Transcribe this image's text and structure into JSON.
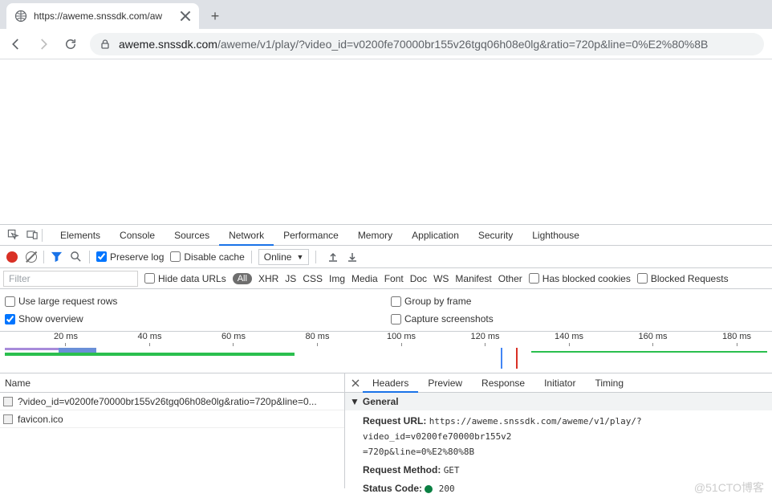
{
  "browser": {
    "tab_title": "https://aweme.snssdk.com/aw",
    "url_host": "aweme.snssdk.com",
    "url_path": "/aweme/v1/play/?video_id=v0200fe70000br155v26tgq06h08e0lg&ratio=720p&line=0%E2%80%8B"
  },
  "devtools": {
    "tabs": [
      "Elements",
      "Console",
      "Sources",
      "Network",
      "Performance",
      "Memory",
      "Application",
      "Security",
      "Lighthouse"
    ],
    "active_tab": "Network"
  },
  "network": {
    "preserve_log_label": "Preserve log",
    "disable_cache_label": "Disable cache",
    "online_label": "Online",
    "filter_placeholder": "Filter",
    "hide_data_urls_label": "Hide data URLs",
    "all_pill": "All",
    "type_filters": [
      "XHR",
      "JS",
      "CSS",
      "Img",
      "Media",
      "Font",
      "Doc",
      "WS",
      "Manifest",
      "Other"
    ],
    "has_blocked_cookies_label": "Has blocked cookies",
    "blocked_requests_label": "Blocked Requests",
    "use_large_rows_label": "Use large request rows",
    "show_overview_label": "Show overview",
    "group_by_frame_label": "Group by frame",
    "capture_screenshots_label": "Capture screenshots",
    "timeline_ticks": [
      "20 ms",
      "40 ms",
      "60 ms",
      "80 ms",
      "100 ms",
      "120 ms",
      "140 ms",
      "160 ms",
      "180 ms"
    ],
    "name_header": "Name",
    "requests": [
      "?video_id=v0200fe70000br155v26tgq06h08e0lg&ratio=720p&line=0...",
      "favicon.ico"
    ],
    "detail_tabs": [
      "Headers",
      "Preview",
      "Response",
      "Initiator",
      "Timing"
    ],
    "detail_active": "Headers",
    "general_label": "General",
    "req_url_label": "Request URL:",
    "req_url_value": "https://aweme.snssdk.com/aweme/v1/play/?video_id=v0200fe70000br155v2",
    "req_url_value_line2": "=720p&line=0%E2%80%8B",
    "req_method_label": "Request Method:",
    "req_method_value": "GET",
    "status_code_label": "Status Code:",
    "status_code_value": "200"
  },
  "watermark": "@51CTO博客"
}
